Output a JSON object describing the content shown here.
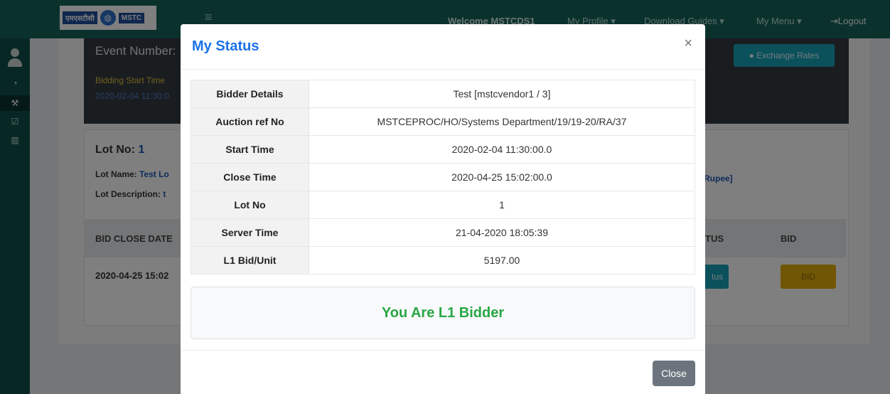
{
  "navbar": {
    "logo_text": "MSTC",
    "welcome": "Welcome MSTCDS1",
    "profile": "My Profile ▾",
    "guides": "Download Guides ▾",
    "menu": "My Menu ▾",
    "logout": "Logout"
  },
  "background": {
    "event_label": "Event Number:",
    "bid_start_label": "Bidding Start Time",
    "bid_start_value": "2020-02-04 11:30:0",
    "exchange_rates": "Exchange Rates",
    "lot_no_label": "Lot No:",
    "lot_no_value": "1",
    "lot_name_label": "Lot Name:",
    "lot_name_value": "Test Lo",
    "lot_desc_label": "Lot Description:",
    "lot_desc_value": "t",
    "currency": "Rupee]",
    "th_close": "BID CLOSE DATE",
    "th_status": "TUS",
    "th_bid": "BID",
    "td_close": "2020-04-25 15:02",
    "status_btn": "tus",
    "bid_btn": "BID"
  },
  "modal": {
    "title": "My Status",
    "close_x": "×",
    "rows": [
      {
        "label": "Bidder Details",
        "value": "Test [mstcvendor1 / 3]"
      },
      {
        "label": "Auction ref No",
        "value": "MSTCEPROC/HO/Systems Department/19/19-20/RA/37"
      },
      {
        "label": "Start Time",
        "value": "2020-02-04 11:30:00.0"
      },
      {
        "label": "Close Time",
        "value": "2020-04-25 15:02:00.0"
      },
      {
        "label": "Lot No",
        "value": "1"
      },
      {
        "label": "Server Time",
        "value": "21-04-2020 18:05:39"
      },
      {
        "label": "L1 Bid/Unit",
        "value": "5197.00"
      }
    ],
    "result": "You Are L1 Bidder",
    "close_button": "Close"
  },
  "colors": {
    "navbar": "#16625a",
    "sidebar": "#0f4e48",
    "title_blue": "#1a73e8",
    "result_green": "#28a745",
    "close_gray": "#6c757d"
  }
}
